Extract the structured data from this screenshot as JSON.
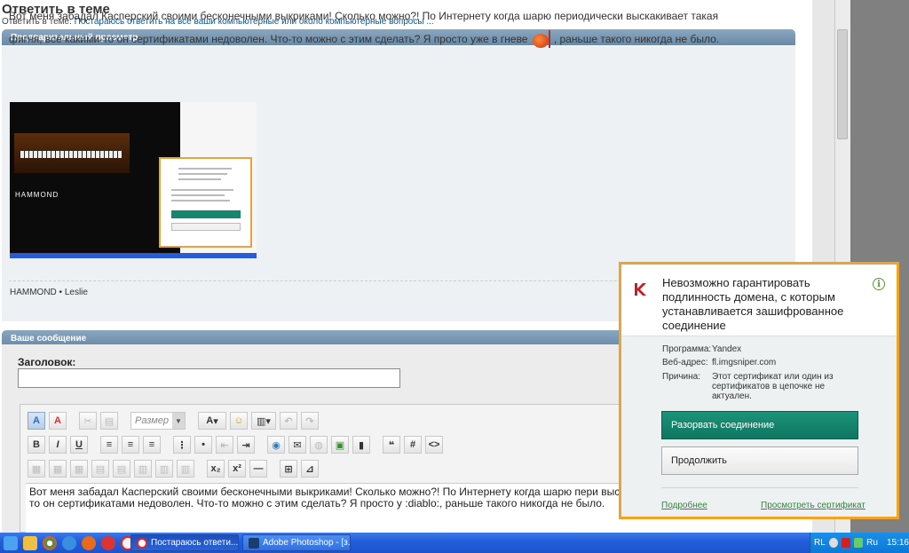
{
  "page": {
    "title": "Ответить в теме",
    "subtitle_prefix": "Ответить в теме: ",
    "subtitle_link": "Постараюсь ответить на все ваши компьютерные или около компьютерные вопросы ..."
  },
  "preview": {
    "header": "Предварительный просмотр",
    "text_line1": "Вот меня забадал Касперский своими бесконечными выкриками! Сколько можно?! По Интернету когда шарю периодически выскакивает такая",
    "text_line2a": "фигня, всё какими-то он сертификатами недоволен. Что-то можно с этим сделать? Я просто уже в гневе",
    "text_line2b": ", раньше такого никогда не было.",
    "embedded_brand": "HAMMOND",
    "signature": "HAMMOND • Leslie"
  },
  "message": {
    "header": "Ваше сообщение",
    "title_label": "Заголовок:",
    "title_value": "",
    "size_select": "Размер",
    "body_text": "Вот меня забадал Касперский своими бесконечными выкриками! Сколько можно?! По Интернету когда шарю пери выскакивает такая фигня, всё какими-то он сертификатами недоволен. Что-то можно с этим сделать? Я просто у :diablo:, раньше такого никогда не было."
  },
  "toolbar": {
    "bold": "B",
    "italic": "I",
    "underline": "U",
    "font": "A",
    "code": "#",
    "html": "<>",
    "subscript": "x₂",
    "superscript": "x²"
  },
  "kaspersky": {
    "heading": "Невозможно гарантировать подлинность домена, с которым устанавливается зашифрованное соединение",
    "program_label": "Программа:",
    "program_value": "Yandex",
    "address_label": "Веб-адрес:",
    "address_value": "fl.imgsniper.com",
    "reason_label": "Причина:",
    "reason_value": "Этот сертификат или один из сертификатов в цепочке не актуален.",
    "disconnect_button": "Разорвать соединение",
    "continue_button": "Продолжить",
    "more_link": "Подробнее",
    "view_cert_link": "Просмотреть сертификат",
    "accent_color": "#f0a326",
    "button_color": "#1b937a"
  },
  "taskbar": {
    "task1": "Постараюсь ответи...",
    "task2": "Adobe Photoshop - [з...",
    "tray_lang": "RL",
    "tray_layout": "Ru",
    "clock": "15:16"
  }
}
